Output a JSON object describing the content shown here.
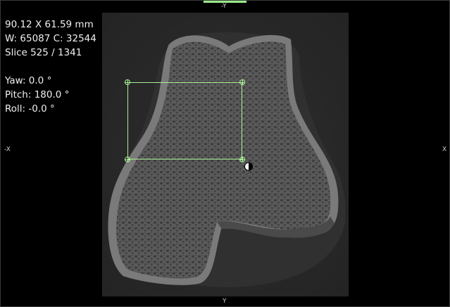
{
  "overlay": {
    "dimensions": "90.12 X 61.59 mm",
    "window_level": "W: 65087 C: 32544",
    "slice": "Slice 525 / 1341",
    "yaw": "Yaw: 0.0 °",
    "pitch": "Pitch: 180.0 °",
    "roll": "Roll: -0.0 °"
  },
  "axes": {
    "top": "-Y",
    "bottom": "Y",
    "left": "-X",
    "right": "X"
  },
  "colors": {
    "roi": "#a8f096",
    "accent": "#9bea8a",
    "background": "#000000"
  },
  "icons": {
    "roi_handle": "crosshair-circle-icon",
    "cursor": "half-filled-circle-cursor-icon"
  }
}
